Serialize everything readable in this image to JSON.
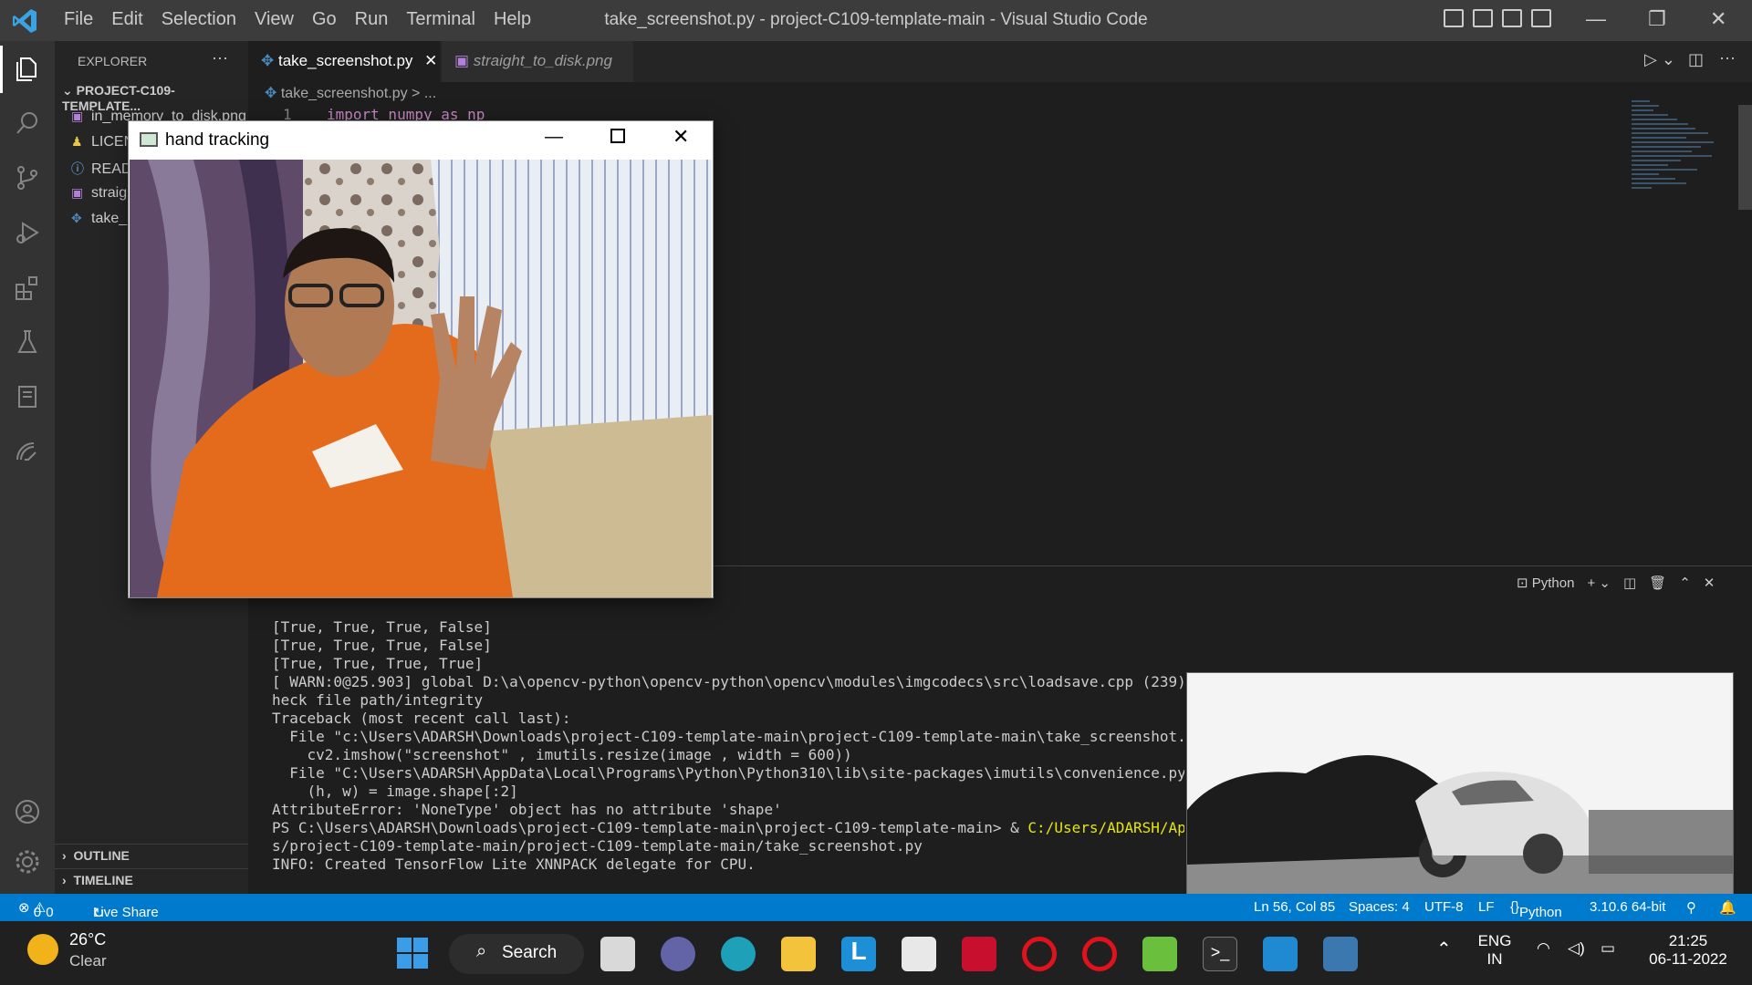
{
  "window_title": "take_screenshot.py - project-C109-template-main - Visual Studio Code",
  "menu": [
    "File",
    "Edit",
    "Selection",
    "View",
    "Go",
    "Run",
    "Terminal",
    "Help"
  ],
  "sidebar": {
    "header": "EXPLORER",
    "more": "···",
    "project": "PROJECT-C109-TEMPLATE...",
    "files": [
      {
        "name": "in_memory_to_disk.png",
        "icon": "image-file-icon"
      },
      {
        "name": "LICEN",
        "icon": "license-icon"
      },
      {
        "name": "READ",
        "icon": "info-icon"
      },
      {
        "name": "straig",
        "icon": "image-file-icon"
      },
      {
        "name": "take_",
        "icon": "python-file-icon"
      }
    ],
    "outline": "OUTLINE",
    "timeline": "TIMELINE"
  },
  "tabs": [
    {
      "label": "take_screenshot.py",
      "active": true
    },
    {
      "label": "straight_to_disk.png",
      "active": false
    }
  ],
  "breadcrumb": "take_screenshot.py > ...",
  "code": {
    "line_number": "1",
    "text": "import numpy as np"
  },
  "panel": {
    "shell": "Python"
  },
  "terminal_lines": [
    "[True, True, True, False]",
    "[True, True, True, False]",
    "[True, True, True, True]",
    "[ WARN:0@25.903] global D:\\a\\opencv-python\\opencv-python\\opencv\\modules\\imgcodecs\\src\\loadsave.cpp (239) cv::fi",
    "heck file path/integrity",
    "Traceback (most recent call last):",
    "  File \"c:\\Users\\ADARSH\\Downloads\\project-C109-template-main\\project-C109-template-main\\take_screenshot.py\", li",
    "    cv2.imshow(\"screenshot\" , imutils.resize(image , width = 600))",
    "  File \"C:\\Users\\ADARSH\\AppData\\Local\\Programs\\Python\\Python310\\lib\\site-packages\\imutils\\convenience.py\", line",
    "    (h, w) = image.shape[:2]",
    "AttributeError: 'NoneType' object has no attribute 'shape'",
    "PS C:\\Users\\ADARSH\\Downloads\\project-C109-template-main\\project-C109-template-main> & ",
    "s/project-C109-template-main/project-C109-template-main/take_screenshot.py",
    "INFO: Created TensorFlow Lite XNNPACK delegate for CPU."
  ],
  "terminal_ps_highlight": "C:/Users/ADARSH/AppData/L",
  "hand_window": {
    "title": "hand tracking"
  },
  "statusbar": {
    "errors": "0",
    "warnings": "0",
    "live_share": "Live Share",
    "position": "Ln 56, Col 85",
    "spaces": "Spaces: 4",
    "encoding": "UTF-8",
    "eol": "LF",
    "language": "Python",
    "interpreter": "3.10.6 64-bit"
  },
  "taskbar": {
    "weather_temp": "26°C",
    "weather_desc": "Clear",
    "search": "Search",
    "lang1": "ENG",
    "lang2": "IN",
    "time": "21:25",
    "date": "06-11-2022"
  },
  "colors": {
    "accent": "#007acc",
    "titlebar": "#3c3c3c",
    "activity": "#333333",
    "sidebar": "#252526",
    "editor": "#1e1e1e",
    "taskbar": "#202020"
  }
}
